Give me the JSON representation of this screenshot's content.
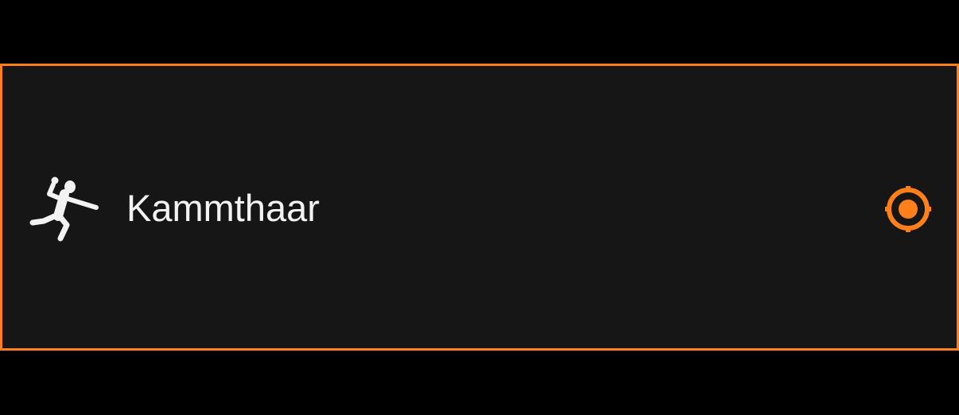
{
  "option": {
    "label": "Kammthaar",
    "icon": "handball-icon",
    "selected": true
  },
  "colors": {
    "page_background": "#000000",
    "card_background": "#161616",
    "accent": "#ff7f1a",
    "text": "#f2f2f2"
  }
}
